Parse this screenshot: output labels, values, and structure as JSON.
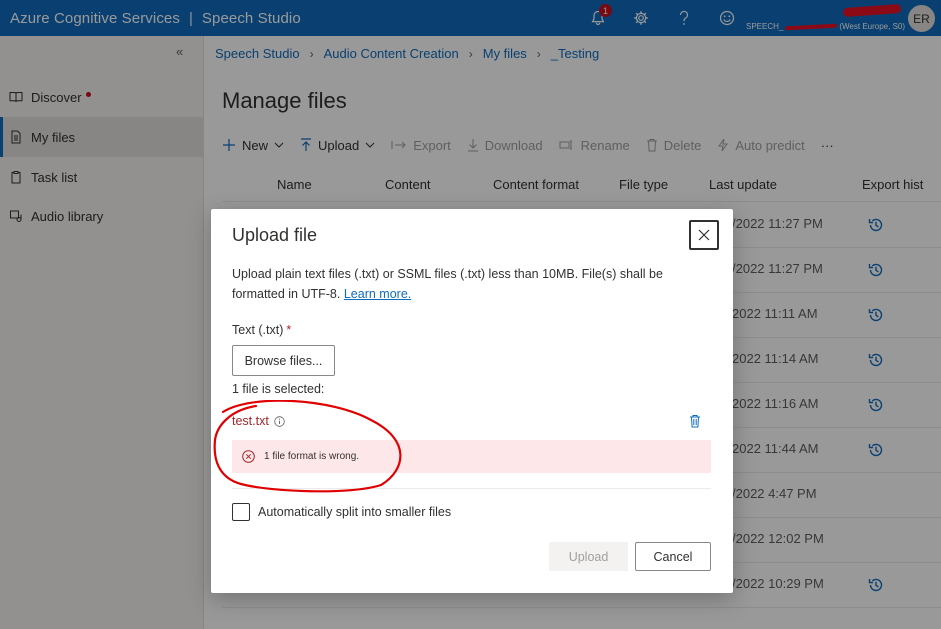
{
  "app": {
    "brand": "Azure Cognitive Services",
    "separator": "|",
    "product": "Speech Studio",
    "notification_count": "1",
    "account_prefix": "SPEECH_",
    "account_suffix": "(West Europe, S0)",
    "avatar_initials": "ER"
  },
  "sidebar": {
    "collapse_glyph": "«",
    "items": [
      {
        "label": "Discover",
        "icon": "book-icon"
      },
      {
        "label": "My files",
        "icon": "document-icon"
      },
      {
        "label": "Task list",
        "icon": "clipboard-icon"
      },
      {
        "label": "Audio library",
        "icon": "audio-library-icon"
      }
    ]
  },
  "breadcrumb": [
    "Speech Studio",
    "Audio Content Creation",
    "My files",
    "_Testing"
  ],
  "page": {
    "title": "Manage files"
  },
  "toolbar": {
    "new": "New",
    "upload": "Upload",
    "export": "Export",
    "download": "Download",
    "rename": "Rename",
    "delete": "Delete",
    "auto_predict": "Auto predict",
    "more": "···"
  },
  "table": {
    "columns": [
      "Name",
      "Content",
      "Content format",
      "File type",
      "Last update",
      "Export hist"
    ],
    "rows": [
      {
        "last_update": "/2022 11:27 PM",
        "has_history": true
      },
      {
        "last_update": "/2022 11:27 PM",
        "has_history": true
      },
      {
        "last_update": "2022 11:11 AM",
        "has_history": true
      },
      {
        "last_update": "2022 11:14 AM",
        "has_history": true
      },
      {
        "last_update": "2022 11:16 AM",
        "has_history": true
      },
      {
        "last_update": "2022 11:44 AM",
        "has_history": true
      },
      {
        "last_update": "/2022 4:47 PM",
        "has_history": false
      },
      {
        "last_update": "/2022 12:02 PM",
        "has_history": false
      },
      {
        "last_update": "/2022 10:29 PM",
        "has_history": true
      }
    ]
  },
  "dialog": {
    "title": "Upload file",
    "description": "Upload plain text files (.txt) or SSML files (.txt) less than 10MB. File(s) shall be formatted in UTF-8.",
    "learn_more": "Learn more.",
    "field_label": "Text (.txt)",
    "required_mark": "*",
    "browse_label": "Browse files...",
    "selected_count": "1 file is selected:",
    "file_name": "test.txt",
    "error_message": "1 file format is wrong.",
    "checkbox_label": "Automatically split into smaller files",
    "upload_label": "Upload",
    "cancel_label": "Cancel"
  },
  "colors": {
    "topbar": "#0f6cbd",
    "link": "#0f6cbd",
    "error": "#a4262c",
    "error_bg": "#fde7e9",
    "annotation": "#e00000"
  }
}
